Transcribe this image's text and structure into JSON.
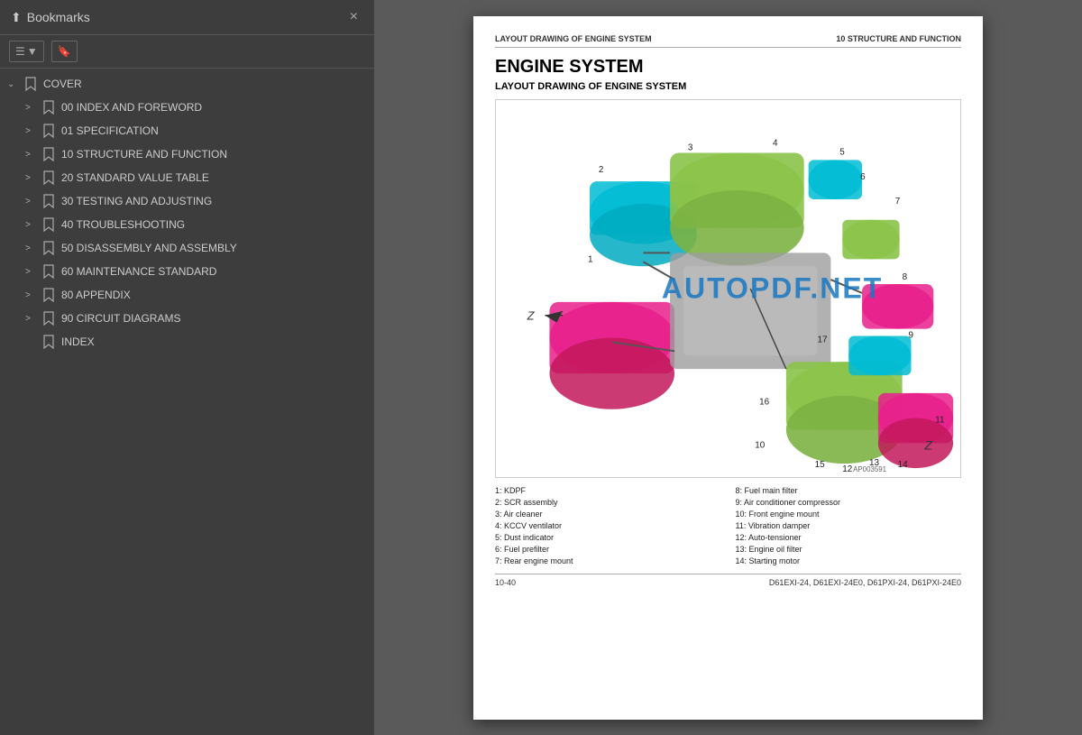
{
  "leftPanel": {
    "title": "Bookmarks",
    "closeBtn": "×",
    "toolbarBtn1": "≡▾",
    "toolbarBtn2": "🔖",
    "coverItem": {
      "label": "COVER",
      "expanded": true
    },
    "items": [
      {
        "label": "00 INDEX AND FOREWORD",
        "indent": 1,
        "hasToggle": true
      },
      {
        "label": "01 SPECIFICATION",
        "indent": 1,
        "hasToggle": true
      },
      {
        "label": "10 STRUCTURE AND FUNCTION",
        "indent": 1,
        "hasToggle": true
      },
      {
        "label": "20 STANDARD VALUE TABLE",
        "indent": 1,
        "hasToggle": true
      },
      {
        "label": "30 TESTING AND ADJUSTING",
        "indent": 1,
        "hasToggle": true
      },
      {
        "label": "40 TROUBLESHOOTING",
        "indent": 1,
        "hasToggle": true
      },
      {
        "label": "50 DISASSEMBLY AND ASSEMBLY",
        "indent": 1,
        "hasToggle": true
      },
      {
        "label": "60 MAINTENANCE STANDARD",
        "indent": 1,
        "hasToggle": true
      },
      {
        "label": "80 APPENDIX",
        "indent": 1,
        "hasToggle": true
      },
      {
        "label": "90 CIRCUIT DIAGRAMS",
        "indent": 1,
        "hasToggle": true
      },
      {
        "label": "INDEX",
        "indent": 1,
        "hasToggle": false
      }
    ]
  },
  "rightPanel": {
    "header": {
      "left": "LAYOUT DRAWING OF ENGINE SYSTEM",
      "right": "10 STRUCTURE AND FUNCTION"
    },
    "mainTitle": "ENGINE SYSTEM",
    "subTitle": "LAYOUT DRAWING OF ENGINE SYSTEM",
    "watermark": "AUTOPDF.NET",
    "diagramLabel": "AP003591",
    "zLabelTop": "Z ➤",
    "zLabelBottom": "Z",
    "legend": [
      {
        "num": "1",
        "text": "KDPF"
      },
      {
        "num": "2",
        "text": "SCR assembly"
      },
      {
        "num": "3",
        "text": "Air cleaner"
      },
      {
        "num": "4",
        "text": "KCCV ventilator"
      },
      {
        "num": "5",
        "text": "Dust indicator"
      },
      {
        "num": "6",
        "text": "Fuel prefilter"
      },
      {
        "num": "7",
        "text": "Rear engine mount"
      },
      {
        "num": "8",
        "text": "Fuel main filter"
      },
      {
        "num": "9",
        "text": "Air conditioner compressor"
      },
      {
        "num": "10",
        "text": "Front engine mount"
      },
      {
        "num": "11",
        "text": "Vibration damper"
      },
      {
        "num": "12",
        "text": "Auto-tensioner"
      },
      {
        "num": "13",
        "text": "Engine oil filter"
      },
      {
        "num": "14",
        "text": "Starting motor"
      }
    ],
    "footer": {
      "pageNum": "10-40",
      "modelInfo": "D61EXI-24, D61EXI-24E0, D61PXI-24, D61PXI-24E0"
    }
  }
}
